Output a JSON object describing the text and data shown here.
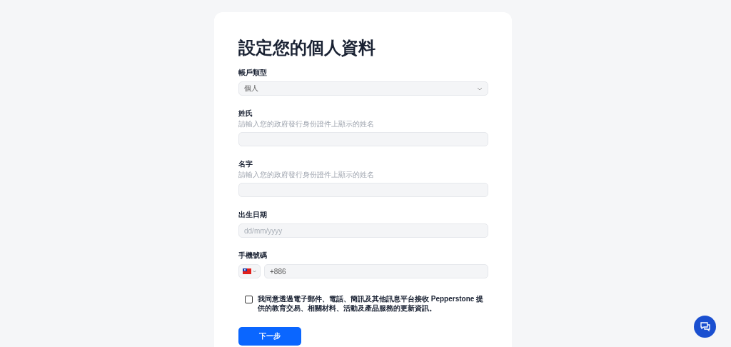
{
  "title": "設定您的個人資料",
  "fields": [
    {
      "kind": "select",
      "label": "帳戶類型",
      "value": "個人"
    },
    {
      "kind": "text",
      "label": "姓氏",
      "hint": "請輸入您的政府發行身份證件上顯示的姓名"
    },
    {
      "kind": "text",
      "label": "名字",
      "hint": "請輸入您的政府發行身份證件上顯示的姓名"
    },
    {
      "kind": "date",
      "label": "出生日期",
      "placeholder": "dd/mm/yyyy"
    },
    {
      "kind": "phone",
      "label": "手機號碼",
      "value": "+886"
    }
  ],
  "consent": {
    "checked": false,
    "text": "我同意透過電子郵件、電話、簡訊及其他訊息平台接收 Pepperstone 提供的教育交易、相關材料、活動及產品服務的更新資訊。"
  },
  "next_button": "下一步"
}
